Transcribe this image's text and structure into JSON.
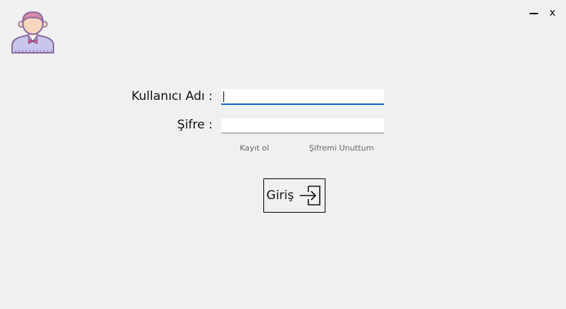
{
  "window": {
    "minimize_icon": "minimize-icon",
    "close_label": "x"
  },
  "avatar": {
    "icon": "user-avatar-icon"
  },
  "form": {
    "username_label": "Kullanıcı Adı :",
    "username_value": "",
    "password_label": "Şifre :",
    "password_value": "",
    "register_link": "Kayıt ol",
    "forgot_link": "Şifremi Unuttum",
    "login_button_label": "Giriş",
    "login_icon": "sign-in-icon"
  },
  "colors": {
    "background": "#f0f0f0",
    "focus_underline": "#0a64c8",
    "link_text": "#6a6a6a"
  }
}
